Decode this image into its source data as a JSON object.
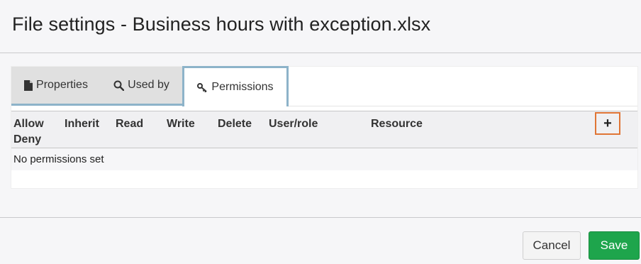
{
  "dialog": {
    "title": "File settings - Business hours with exception.xlsx"
  },
  "tabs": [
    {
      "label": "Properties",
      "icon": "file-icon",
      "active": false
    },
    {
      "label": "Used by",
      "icon": "search-icon",
      "active": false
    },
    {
      "label": "Permissions",
      "icon": "key-icon",
      "active": true
    }
  ],
  "table": {
    "columns": [
      "Allow\nDeny",
      "Inherit",
      "Read",
      "Write",
      "Delete",
      "User/role",
      "Resource"
    ],
    "add_label": "+",
    "empty_message": "No permissions set"
  },
  "footer": {
    "cancel_label": "Cancel",
    "save_label": "Save"
  },
  "colors": {
    "tab_accent": "#8db3c9",
    "add_button_border": "#e07535",
    "save_button": "#1ea54c"
  }
}
